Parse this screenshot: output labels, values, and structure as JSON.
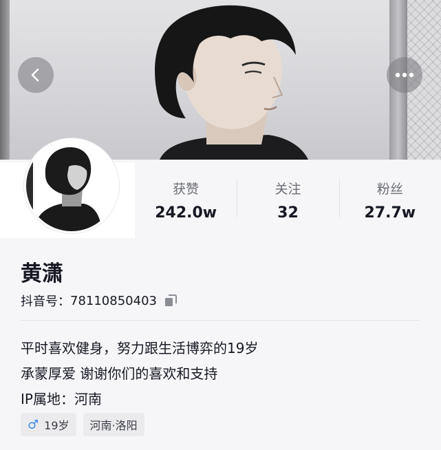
{
  "header": {
    "back_icon": "chevron-left-icon",
    "more_icon": "more-horizontal-icon"
  },
  "stats": [
    {
      "label": "获赞",
      "value": "242.0w"
    },
    {
      "label": "关注",
      "value": "32"
    },
    {
      "label": "粉丝",
      "value": "27.7w"
    }
  ],
  "profile": {
    "name": "黄潇",
    "id_label": "抖音号：",
    "id_value": "78110850403",
    "copy_icon": "copy-icon",
    "bio_line1": "平时喜欢健身，努力跟生活博弈的19岁",
    "bio_line2": "承蒙厚爱 谢谢你们的喜欢和支持",
    "ip_label": "IP属地：",
    "ip_value": "河南"
  },
  "tags": {
    "gender_symbol": "♂",
    "age": "19岁",
    "location": "河南·洛阳"
  },
  "colors": {
    "background": "#f6f6f8",
    "text": "#161823",
    "secondary_text": "#6b6d75",
    "male_blue": "#3f8ae6"
  }
}
